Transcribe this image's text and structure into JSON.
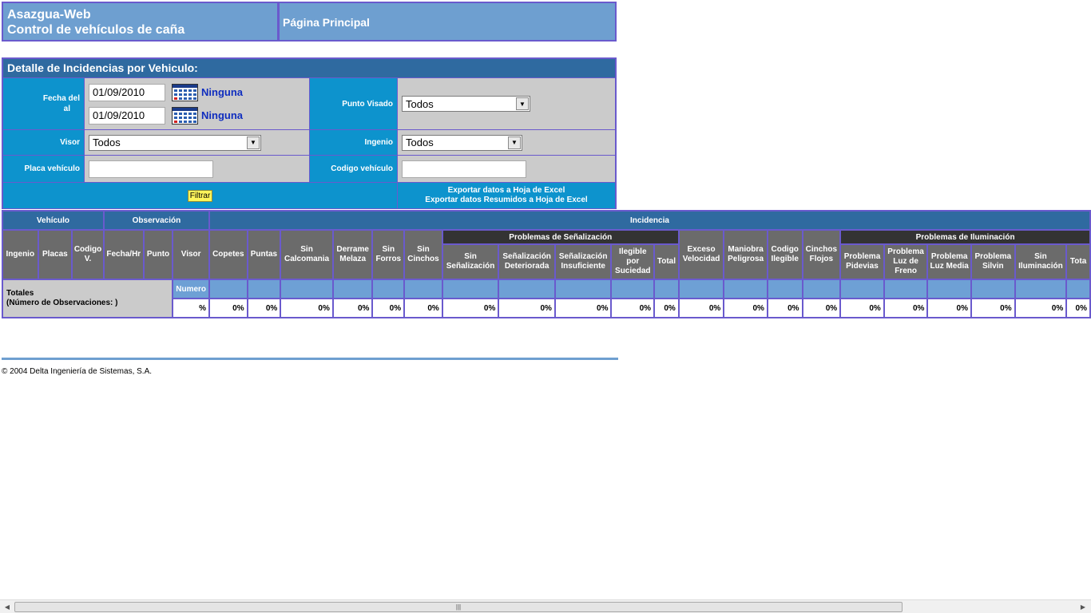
{
  "header": {
    "app_name": "Asazgua-Web",
    "app_subtitle": "Control de vehículos de caña",
    "page_link": "Página Principal"
  },
  "filter": {
    "title": "Detalle de Incidencias por Vehiculo:",
    "fecha_label_1": "Fecha del",
    "fecha_label_2": "al",
    "fecha_del": "01/09/2010",
    "fecha_al": "01/09/2010",
    "ninguna_1": "Ninguna",
    "ninguna_2": "Ninguna",
    "punto_visado_label": "Punto Visado",
    "punto_visado_value": "Todos",
    "visor_label": "Visor",
    "visor_value": "Todos",
    "ingenio_label": "Ingenio",
    "ingenio_value": "Todos",
    "placa_label": "Placa vehículo",
    "placa_value": "",
    "codigo_label": "Codigo vehículo",
    "codigo_value": "",
    "filtrar_button": "Filtrar",
    "export_full": "Exportar datos a Hoja de Excel",
    "export_summary": "Exportar datos Resumidos a Hoja de Excel",
    "calendar_icon": "calendar-icon"
  },
  "grid": {
    "groups": {
      "vehiculo": "Vehículo",
      "observacion": "Observación",
      "incidencia": "Incidencia"
    },
    "subgroups": {
      "senalizacion": "Problemas de Señalización",
      "iluminacion": "Problemas de Iluminación"
    },
    "columns": {
      "ingenio": "Ingenio",
      "placas": "Placas",
      "codigo_v": "Codigo V.",
      "fecha_hr": "Fecha/Hr",
      "punto": "Punto",
      "visor": "Visor",
      "copetes": "Copetes",
      "puntas": "Puntas",
      "sin_calcomania": "Sin Calcomania",
      "derrame_melaza": "Derrame Melaza",
      "sin_forros": "Sin Forros",
      "sin_cinchos": "Sin Cinchos",
      "sin_senalizacion": "Sin Señalización",
      "senal_deteriorada": "Señalización Deteriorada",
      "senal_insuficiente": "Señalización Insuficiente",
      "ilegible_suciedad": "Ilegible por Suciedad",
      "total": "Total",
      "exceso_velocidad": "Exceso Velocidad",
      "maniobra_peligrosa": "Maniobra Peligrosa",
      "codigo_ilegible": "Codigo Ilegible",
      "cinchos_flojos": "Cinchos Flojos",
      "problema_pidevias": "Problema Pidevias",
      "problema_luz_freno": "Problema Luz de Freno",
      "problema_luz_media": "Problema Luz Media",
      "problema_silvin": "Problema Silvin",
      "sin_iluminacion": "Sin Iluminación",
      "total_ilum": "Tota"
    },
    "totals": {
      "label_1": "Totales",
      "label_2": "(Número de Observaciones: )",
      "numero": "Numero",
      "percent_sign": "%",
      "percent_values": [
        "0%",
        "0%",
        "0%",
        "0%",
        "0%",
        "0%",
        "0%",
        "0%",
        "0%",
        "0%",
        "0%",
        "0%",
        "0%",
        "0%",
        "0%",
        "0%",
        "0%",
        "0%",
        "0%",
        "0%",
        "0%"
      ]
    }
  },
  "footer": {
    "copyright": "© 2004 Delta Ingeniería de Sistemas, S.A."
  }
}
